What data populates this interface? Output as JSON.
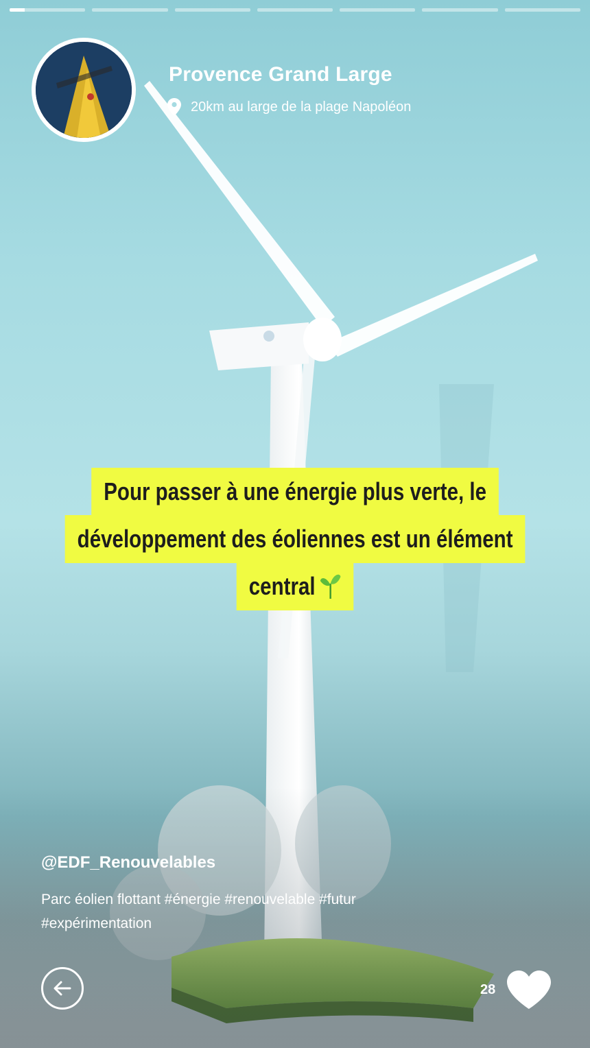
{
  "story": {
    "progress_segments": [
      0.2,
      0,
      0,
      0,
      0,
      0,
      0
    ],
    "title": "Provence Grand Large",
    "location": {
      "icon": "location-pin-icon",
      "text": "20km au large de la plage Napoléon"
    },
    "caption_lines": [
      "Pour passer à une énergie plus verte, le",
      "développement des éoliennes est un élément",
      "central"
    ],
    "caption_emoji": "sprout-icon",
    "author_handle": "@EDF_Renouvelables",
    "description": "Parc éolien flottant #énergie #renouvelable #futur #expérimentation",
    "likes_count": "28",
    "colors": {
      "caption_highlight": "#f0fb42",
      "text": "#ffffff",
      "sky": "#a6dbe2"
    }
  }
}
